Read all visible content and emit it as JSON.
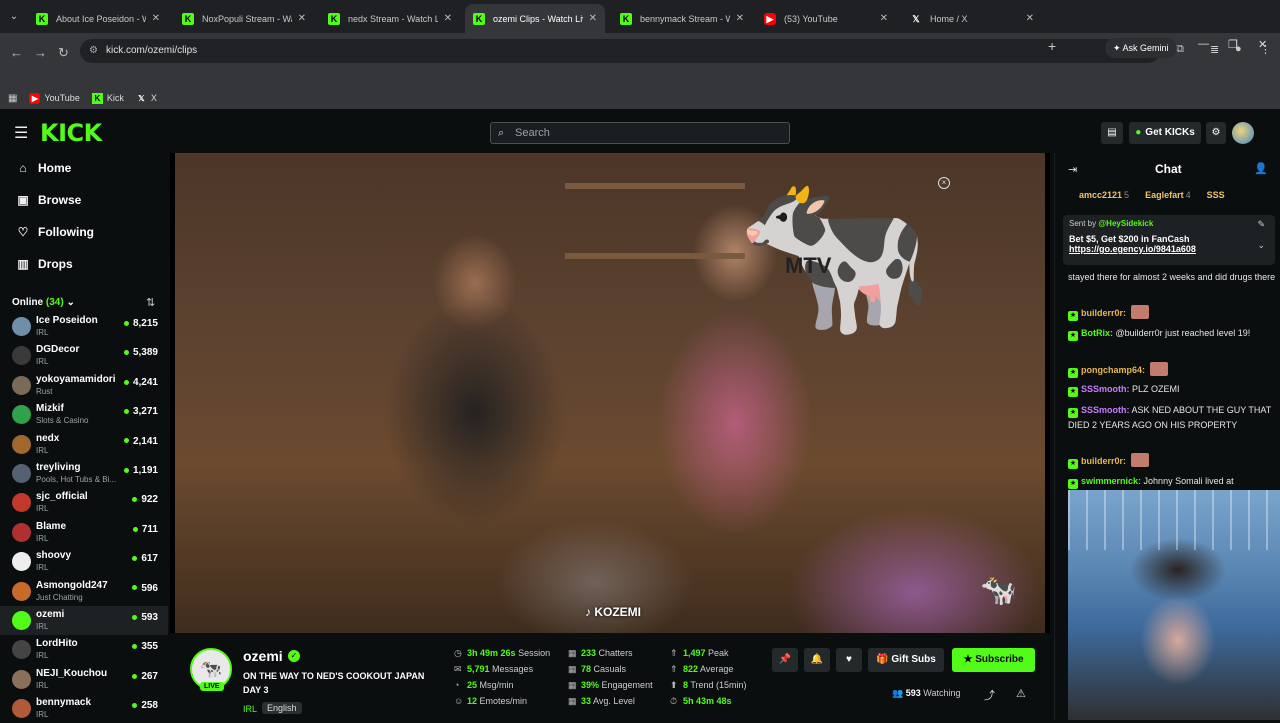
{
  "browser": {
    "tabs": [
      {
        "label": "About Ice Poseidon - W",
        "icon": "kick",
        "active": false
      },
      {
        "label": "NoxPopuli Stream - Watch",
        "icon": "kick",
        "active": false
      },
      {
        "label": "nedx Stream - Watch Live o",
        "icon": "kick",
        "active": false
      },
      {
        "label": "ozemi Clips - Watch Live o",
        "icon": "kick",
        "active": true
      },
      {
        "label": "bennymack Stream - Watch",
        "icon": "kick",
        "active": false
      },
      {
        "label": "(53) YouTube",
        "icon": "youtube",
        "active": false
      },
      {
        "label": "Home / X",
        "icon": "x",
        "active": false
      }
    ],
    "gemini_label": "Ask Gemini",
    "url": "kick.com/ozemi/clips",
    "bookmarks": [
      {
        "label": "YouTube",
        "icon": "youtube"
      },
      {
        "label": "Kick",
        "icon": "kick"
      },
      {
        "label": "X",
        "icon": "x"
      }
    ]
  },
  "header": {
    "logo": "KICK",
    "search_placeholder": "Search",
    "get_kicks_label": "Get KICKs"
  },
  "sidebar": {
    "nav": [
      {
        "label": "Home",
        "icon": "home-icon"
      },
      {
        "label": "Browse",
        "icon": "browse-icon"
      },
      {
        "label": "Following",
        "icon": "heart-icon"
      },
      {
        "label": "Drops",
        "icon": "drops-icon"
      }
    ],
    "online_label": "Online",
    "online_count": "(34)",
    "channels": [
      {
        "name": "Ice Poseidon",
        "category": "IRL",
        "viewers": "8,215",
        "color": "#6f8fa8"
      },
      {
        "name": "DGDecor",
        "category": "IRL",
        "viewers": "5,389",
        "color": "#3a3a3a"
      },
      {
        "name": "yokoyamamidori",
        "category": "Rust",
        "viewers": "4,241",
        "color": "#7a6b58"
      },
      {
        "name": "Mizkif",
        "category": "Slots & Casino",
        "viewers": "3,271",
        "color": "#2fa24a"
      },
      {
        "name": "nedx",
        "category": "IRL",
        "viewers": "2,141",
        "color": "#a0682f"
      },
      {
        "name": "treyliving",
        "category": "Pools, Hot Tubs & Bi...",
        "viewers": "1,191",
        "color": "#556070"
      },
      {
        "name": "sjc_official",
        "category": "IRL",
        "viewers": "922",
        "color": "#c0392b"
      },
      {
        "name": "Blame",
        "category": "IRL",
        "viewers": "711",
        "color": "#b03030"
      },
      {
        "name": "shoovy",
        "category": "IRL",
        "viewers": "617",
        "color": "#eeeeee"
      },
      {
        "name": "Asmongold247",
        "category": "Just Chatting",
        "viewers": "596",
        "color": "#c86b2a"
      },
      {
        "name": "ozemi",
        "category": "IRL",
        "viewers": "593",
        "color": "#53fc18"
      },
      {
        "name": "LordHito",
        "category": "IRL",
        "viewers": "355",
        "color": "#444444"
      },
      {
        "name": "NEJI_Kouchou",
        "category": "IRL",
        "viewers": "267",
        "color": "#8a6f5a"
      },
      {
        "name": "bennymack",
        "category": "IRL",
        "viewers": "258",
        "color": "#b05a3a"
      }
    ]
  },
  "video": {
    "watermark_text": "MTV",
    "caption": "KOZEMI"
  },
  "stream": {
    "name": "ozemi",
    "live_label": "LIVE",
    "title": "ON THE WAY TO NED'S COOKOUT JAPAN DAY 3",
    "category": "IRL",
    "language": "English",
    "stats": [
      {
        "value": "3h 49m 26s",
        "label": "Session",
        "icon": "clock-icon"
      },
      {
        "value": "233",
        "label": "Chatters",
        "icon": "chatters-icon"
      },
      {
        "value": "1,497",
        "label": "Peak",
        "icon": "peak-icon"
      },
      {
        "value": "5,791",
        "label": "Messages",
        "icon": "messages-icon"
      },
      {
        "value": "78",
        "label": "Casuals",
        "icon": "casuals-icon"
      },
      {
        "value": "822",
        "label": "Average",
        "icon": "average-icon"
      },
      {
        "value": "25",
        "label": "Msg/min",
        "icon": "msgmin-icon"
      },
      {
        "value": "39%",
        "label": "Engagement",
        "icon": "engagement-icon"
      },
      {
        "value": "8",
        "label": "Trend (15min)",
        "icon": "trend-icon"
      },
      {
        "value": "12",
        "label": "Emotes/min",
        "icon": "emotes-icon"
      },
      {
        "value": "33",
        "label": "Avg. Level",
        "icon": "level-icon"
      },
      {
        "value": "5h 43m 48s",
        "label": "",
        "icon": "timer-icon"
      }
    ],
    "gift_subs_label": "Gift Subs",
    "subscribe_label": "Subscribe",
    "watching_count": "593",
    "watching_label": "Watching"
  },
  "chat": {
    "title": "Chat",
    "leaderboard": [
      {
        "name": "amcc2121",
        "rank": "5"
      },
      {
        "name": "Eaglefart",
        "rank": "4"
      },
      {
        "name": "SSS",
        "rank": ""
      }
    ],
    "pinned": {
      "sent_by_label": "Sent by",
      "sender": "@HeySidekick",
      "offer": "Bet $5, Get $200 in FanCash",
      "link": "https://go.egency.io/9841a608"
    },
    "messages": [
      {
        "user": "",
        "text": "stayed there for almost 2 weeks and did drugs there",
        "color": "#e6e6e6",
        "emote": false
      },
      {
        "user": "builderr0r:",
        "text": "",
        "color": "#e8b84a",
        "emote": true
      },
      {
        "user": "BotRix:",
        "text": "@builderr0r just reached level 19!",
        "color": "#53fc18",
        "emote": false
      },
      {
        "user": "pongchamp64:",
        "text": "",
        "color": "#e8b84a",
        "emote": true
      },
      {
        "user": "SSSmooth:",
        "text": "PLZ OZEMI",
        "color": "#c77dff",
        "emote": false
      },
      {
        "user": "SSSmooth:",
        "text": "ASK NED ABOUT THE GUY THAT DIED 2 YEARS AGO ON HIS PROPERTY",
        "color": "#c77dff",
        "emote": false
      },
      {
        "user": "builderr0r:",
        "text": "",
        "color": "#e8b84a",
        "emote": true
      },
      {
        "user": "swimmernick:",
        "text": "Johnny Somali lived at",
        "color": "#53fc18",
        "emote": false
      }
    ]
  }
}
